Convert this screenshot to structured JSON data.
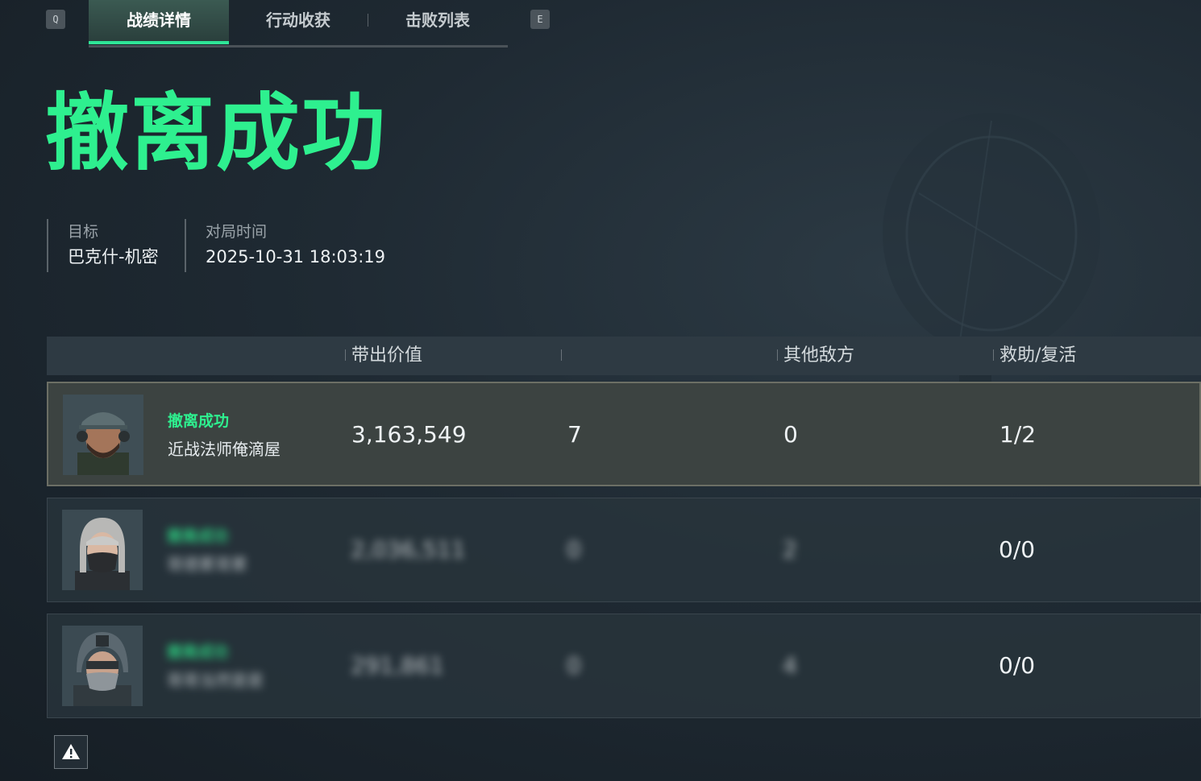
{
  "tabs": {
    "prev_key": "Q",
    "next_key": "E",
    "items": [
      {
        "label": "战绩详情",
        "active": true
      },
      {
        "label": "行动收获",
        "active": false
      },
      {
        "label": "击败列表",
        "active": false
      }
    ]
  },
  "result": {
    "title": "撤离成功",
    "title_color": "#2ef08f"
  },
  "info": {
    "target_label": "目标",
    "target_value": "巴克什-机密",
    "time_label": "对局时间",
    "time_value": "2025-10-31 18:03:19"
  },
  "table": {
    "columns": [
      "",
      "带出价值",
      "",
      "其他敌方",
      "救助/复活"
    ],
    "rows": [
      {
        "status": "撤离成功",
        "name": "近战法师俺滴屋",
        "value": "3,163,549",
        "col3": "7",
        "others": "0",
        "rescue": "1/2",
        "blurred": false,
        "avatar": "male-operator-cap-icon"
      },
      {
        "status": "撤离成功",
        "name": "哥德累哥累",
        "value": "2,036,511",
        "col3": "0",
        "others": "2",
        "rescue": "0/0",
        "blurred": true,
        "avatar": "female-operator-mask-icon"
      },
      {
        "status": "撤离成功",
        "name": "哥哥当然是是",
        "value": "291,861",
        "col3": "0",
        "others": "4",
        "rescue": "0/0",
        "blurred": true,
        "avatar": "helmet-operator-icon"
      }
    ]
  },
  "footer": {
    "warning_icon": "warning-icon"
  }
}
